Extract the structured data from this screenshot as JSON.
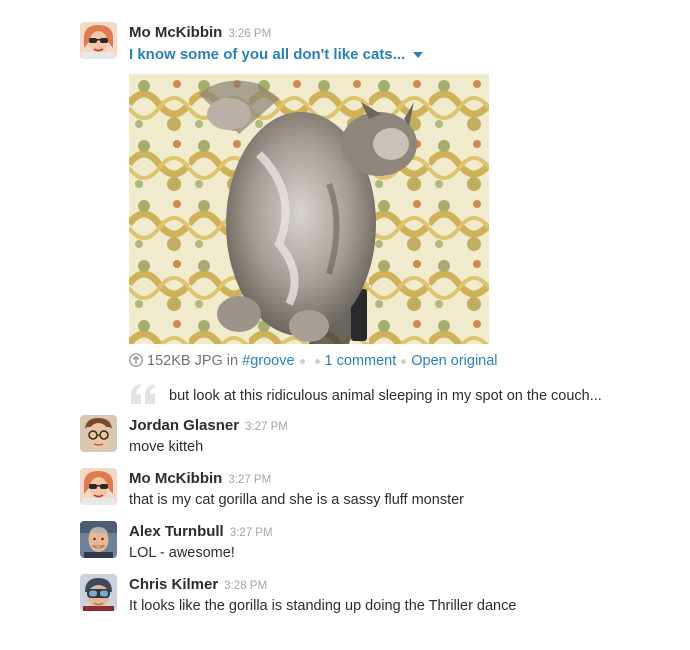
{
  "messages": [
    {
      "author": "Mo McKibbin",
      "time": "3:26 PM",
      "avatar": "woman-sunglasses-avatar",
      "file": {
        "title": "I know some of you all don't like cats...",
        "image": "cat-sleeping-on-couch-photo",
        "size": "152KB JPG",
        "in_label": "in",
        "channel": "#groove",
        "comments": "1 comment",
        "open_label": "Open original",
        "comment_text": "but look at this ridiculous animal sleeping in my spot on the couch..."
      }
    },
    {
      "author": "Jordan Glasner",
      "time": "3:27 PM",
      "avatar": "man-glasses-avatar",
      "text": "move kitteh"
    },
    {
      "author": "Mo McKibbin",
      "time": "3:27 PM",
      "avatar": "woman-sunglasses-avatar",
      "text": "that is my cat gorilla and she is a sassy fluff monster"
    },
    {
      "author": "Alex Turnbull",
      "time": "3:27 PM",
      "avatar": "man-smiling-avatar",
      "text": "LOL - awesome!"
    },
    {
      "author": "Chris Kilmer",
      "time": "3:28 PM",
      "avatar": "man-goggles-avatar",
      "text": "It looks like the gorilla is standing up doing the Thriller dance"
    }
  ],
  "colors": {
    "link": "#2a80b9",
    "timestamp": "#a6a6a6",
    "text": "#2c2d30",
    "meta": "#717274"
  }
}
